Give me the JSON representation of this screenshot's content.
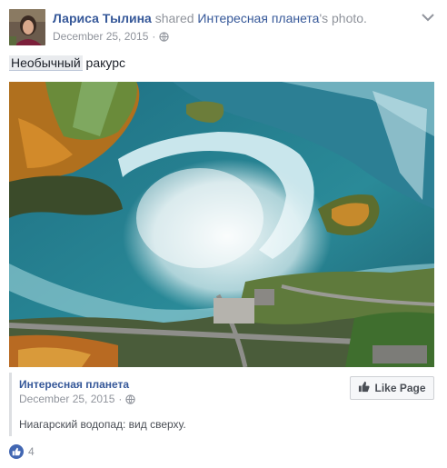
{
  "header": {
    "author": "Лариса Тылина",
    "shared_word": "shared",
    "page_name": "Интересная планета",
    "object_suffix": "'s photo.",
    "date": "December 25, 2015",
    "separator": "·",
    "privacy_icon": "globe-icon",
    "menu_icon": "chevron-down-icon"
  },
  "message": {
    "highlighted_word": "Необычный",
    "rest": " ракурс"
  },
  "photo": {
    "subject": "aerial-waterfall-photo"
  },
  "attachment": {
    "page_name": "Интересная планета",
    "date": "December 25, 2015",
    "separator": "·",
    "description": "Ниагарский водопад: вид сверху.",
    "like_page_label": "Like Page"
  },
  "reactions": {
    "icon": "like-icon",
    "count": "4"
  },
  "colors": {
    "link": "#365899",
    "meta": "#90949c",
    "like_blue": "#4267b2"
  }
}
